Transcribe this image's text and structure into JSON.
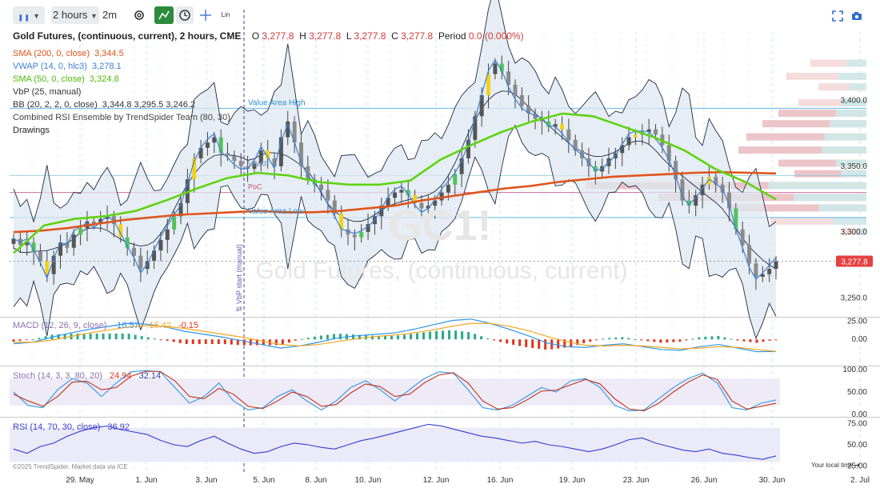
{
  "toolbar": {
    "timeframe": "2 hours",
    "interval": "2m",
    "scale_label": "Lin"
  },
  "header": {
    "symbol_title": "Gold Futures, (continuous, current), 2 hours, CME",
    "o_label": "O",
    "o_value": "3,277.8",
    "h_label": "H",
    "h_value": "3,277.8",
    "l_label": "L",
    "l_value": "3,277.8",
    "c_label": "C",
    "c_value": "3,277.8",
    "period_label": "Period",
    "period_value": "0.0 (0.000%)"
  },
  "indicators": [
    {
      "label": "SMA (200, 0, close)",
      "value": "3,344.5",
      "color": "#e0541b"
    },
    {
      "label": "VWAP (14, 0, hlc3)",
      "value": "3,278.1",
      "color": "#3b7fd4"
    },
    {
      "label": "SMA (50, 0, close)",
      "value": "3,324.8",
      "color": "#5fd312"
    },
    {
      "label": "VbP (25, manual)",
      "value": "",
      "color": "#333333"
    },
    {
      "label": "BB (20, 2, 2, 0, close)",
      "value": "3,344.8  3,295.5  3,246.2",
      "color": "#333333"
    },
    {
      "label": "Combined RSI Ensemble by TrendSpider Team (80, 30)",
      "value": "",
      "color": "#444444"
    },
    {
      "label": "Drawings",
      "value": "",
      "color": "#222222"
    }
  ],
  "watermark": {
    "symbol": "GC1!",
    "name": "Gold Futures, (continuous, current)"
  },
  "annotations": {
    "value_area_high": "Value Area High",
    "value_area_low": "Value Area Low",
    "vwap": "VWAP",
    "poc": "PoC",
    "vbp_start": "⇅ VbP start (manual)",
    "copyright": "©2025 TrendSpider. Market data via ICE",
    "local_time": "Your local time ➜"
  },
  "chart_data": [
    {
      "type": "candlestick",
      "title": "Gold Futures, (continuous, current), 2 hours, CME",
      "x_ticks": [
        "29. May",
        "1. Jun",
        "3. Jun",
        "5. Jun",
        "8. Jun",
        "10. Jun",
        "12. Jun",
        "16. Jun",
        "19. Jun",
        "23. Jun",
        "26. Jun",
        "30. Jun",
        "2. Jul"
      ],
      "y_ticks": [
        "3,400.0",
        "3,350.0",
        "3,300.0",
        "3,250.0"
      ],
      "ylim": [
        3238,
        3452
      ],
      "last_price": "3,277.8",
      "value_area_high": 3394,
      "value_area_low": 3311,
      "poc": 3330,
      "closes": [
        3295,
        3290,
        3292,
        3285,
        3278,
        3268,
        3282,
        3292,
        3288,
        3298,
        3303,
        3308,
        3306,
        3310,
        3312,
        3306,
        3296,
        3288,
        3282,
        3272,
        3278,
        3286,
        3294,
        3302,
        3312,
        3322,
        3340,
        3356,
        3364,
        3368,
        3372,
        3360,
        3358,
        3354,
        3350,
        3348,
        3352,
        3362,
        3356,
        3350,
        3372,
        3384,
        3368,
        3350,
        3340,
        3336,
        3332,
        3324,
        3314,
        3302,
        3298,
        3296,
        3300,
        3306,
        3312,
        3320,
        3326,
        3330,
        3332,
        3328,
        3322,
        3318,
        3320,
        3324,
        3330,
        3336,
        3344,
        3356,
        3370,
        3388,
        3404,
        3420,
        3428,
        3422,
        3412,
        3404,
        3396,
        3390,
        3386,
        3384,
        3380,
        3382,
        3378,
        3370,
        3362,
        3356,
        3350,
        3346,
        3350,
        3356,
        3360,
        3366,
        3372,
        3374,
        3376,
        3378,
        3374,
        3366,
        3354,
        3340,
        3324,
        3320,
        3328,
        3336,
        3342,
        3336,
        3330,
        3318,
        3302,
        3290,
        3276,
        3266,
        3268,
        3272,
        3277.8
      ],
      "sma200": [
        3300,
        3301,
        3303,
        3306,
        3309,
        3311,
        3313,
        3314,
        3315,
        3316,
        3315,
        3315,
        3316,
        3318,
        3320,
        3324,
        3327,
        3330,
        3333,
        3335,
        3338,
        3340,
        3342,
        3343,
        3344,
        3345,
        3345.5,
        3345,
        3344.5
      ],
      "sma50": [
        3284,
        3305,
        3310,
        3312,
        3316,
        3324,
        3333,
        3341,
        3345,
        3343,
        3338,
        3336,
        3336,
        3339,
        3355,
        3366,
        3376,
        3384,
        3390,
        3388,
        3380,
        3372,
        3362,
        3348,
        3338,
        3324.8
      ],
      "vwap_last": 3278.1,
      "bb_upper_last": 3344.8,
      "bb_mid_last": 3295.5,
      "bb_lower_last": 3246.2
    },
    {
      "type": "bar",
      "title": "MACD (12, 26, 9, close)",
      "values_label": [
        "-16.57",
        "-16.42",
        "-0.15"
      ],
      "series_colors": [
        "#2f96e8",
        "#f5a623",
        "#e0341b"
      ],
      "y_ticks": [
        "25.00",
        "0.00"
      ],
      "ylim": [
        -35,
        30
      ],
      "macd": [
        -6,
        -4,
        3,
        9,
        14,
        18,
        22,
        21,
        17,
        11,
        7,
        3,
        -2,
        -7,
        -12,
        -9,
        -4,
        2,
        5,
        7,
        9,
        14,
        20,
        26,
        28,
        22,
        14,
        5,
        -5,
        -10,
        -11,
        -8,
        -6,
        -10,
        -14,
        -15,
        -10,
        -7,
        -12,
        -17,
        -16.57
      ],
      "signal": [
        -4,
        -4,
        -1,
        4,
        9,
        13,
        17,
        19,
        18,
        15,
        11,
        7,
        3,
        -2,
        -7,
        -9,
        -7,
        -3,
        1,
        4,
        6,
        9,
        13,
        18,
        22,
        22,
        18,
        12,
        4,
        -3,
        -8,
        -9,
        -8,
        -9,
        -11,
        -13,
        -12,
        -10,
        -11,
        -14,
        -16.42
      ]
    },
    {
      "type": "line",
      "title": "Stoch (14, 3, 3, 80, 20)",
      "values_label": [
        "24.94",
        "32.14"
      ],
      "series_colors": [
        "#2f96e8",
        "#e0341b"
      ],
      "y_ticks": [
        "100.00",
        "50.00",
        "0.00"
      ],
      "ylim": [
        0,
        100
      ],
      "k": [
        50,
        20,
        15,
        55,
        80,
        70,
        40,
        70,
        95,
        98,
        95,
        60,
        25,
        40,
        70,
        30,
        10,
        15,
        40,
        55,
        30,
        10,
        30,
        60,
        75,
        55,
        30,
        55,
        80,
        95,
        92,
        55,
        15,
        10,
        20,
        40,
        60,
        50,
        75,
        80,
        60,
        20,
        8,
        10,
        35,
        60,
        80,
        92,
        70,
        15,
        10,
        25,
        32.14
      ],
      "d": [
        45,
        30,
        18,
        40,
        72,
        74,
        55,
        60,
        85,
        96,
        96,
        75,
        40,
        35,
        58,
        45,
        18,
        13,
        30,
        50,
        40,
        18,
        22,
        48,
        68,
        62,
        40,
        45,
        70,
        88,
        93,
        70,
        30,
        12,
        15,
        32,
        52,
        54,
        66,
        78,
        68,
        35,
        12,
        8,
        25,
        50,
        72,
        88,
        78,
        30,
        12,
        18,
        24.94
      ]
    },
    {
      "type": "line",
      "title": "RSI (14, 70, 30, close)",
      "values_label": [
        "36.92"
      ],
      "series_colors": [
        "#3a3ad0"
      ],
      "y_ticks": [
        "75.00",
        "50.00",
        "25.00"
      ],
      "ylim": [
        20,
        80
      ],
      "rsi": [
        45,
        40,
        48,
        52,
        60,
        66,
        70,
        72,
        68,
        65,
        62,
        55,
        50,
        48,
        55,
        60,
        52,
        45,
        40,
        42,
        48,
        52,
        50,
        47,
        45,
        50,
        55,
        58,
        62,
        66,
        70,
        74,
        72,
        68,
        64,
        60,
        58,
        55,
        52,
        54,
        50,
        48,
        45,
        42,
        45,
        50,
        56,
        58,
        52,
        48,
        44,
        42,
        45,
        40,
        38,
        35,
        33,
        36.92
      ]
    }
  ]
}
